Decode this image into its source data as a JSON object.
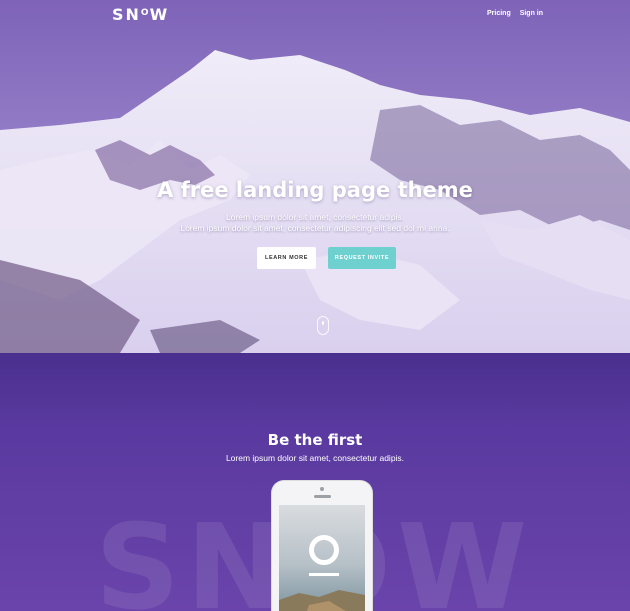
{
  "nav": {
    "logo_main": "SN",
    "logo_o": "O",
    "logo_end": "W",
    "links": [
      "Pricing",
      "Sign in"
    ]
  },
  "hero": {
    "headline": "A free landing page theme",
    "sub_line1": "Lorem ipsum dolor sit amet, consectetur adipis.",
    "sub_line2": "Lorem ipsum dolor sit amet, consectetur adipiscing elit sed dol mi arina.",
    "learn_more": "LEARN MORE",
    "request_invite": "REQUEST INVITE"
  },
  "section": {
    "title": "Be the first",
    "subtitle": "Lorem ipsum dolor sit amet, consectetur adipis.",
    "watermark": "SNOW"
  },
  "colors": {
    "accent_teal": "#6fd0d0",
    "section_purple": "#5a3aa0"
  },
  "icons": [
    "mouse-scroll-icon",
    "phone-mockup"
  ]
}
